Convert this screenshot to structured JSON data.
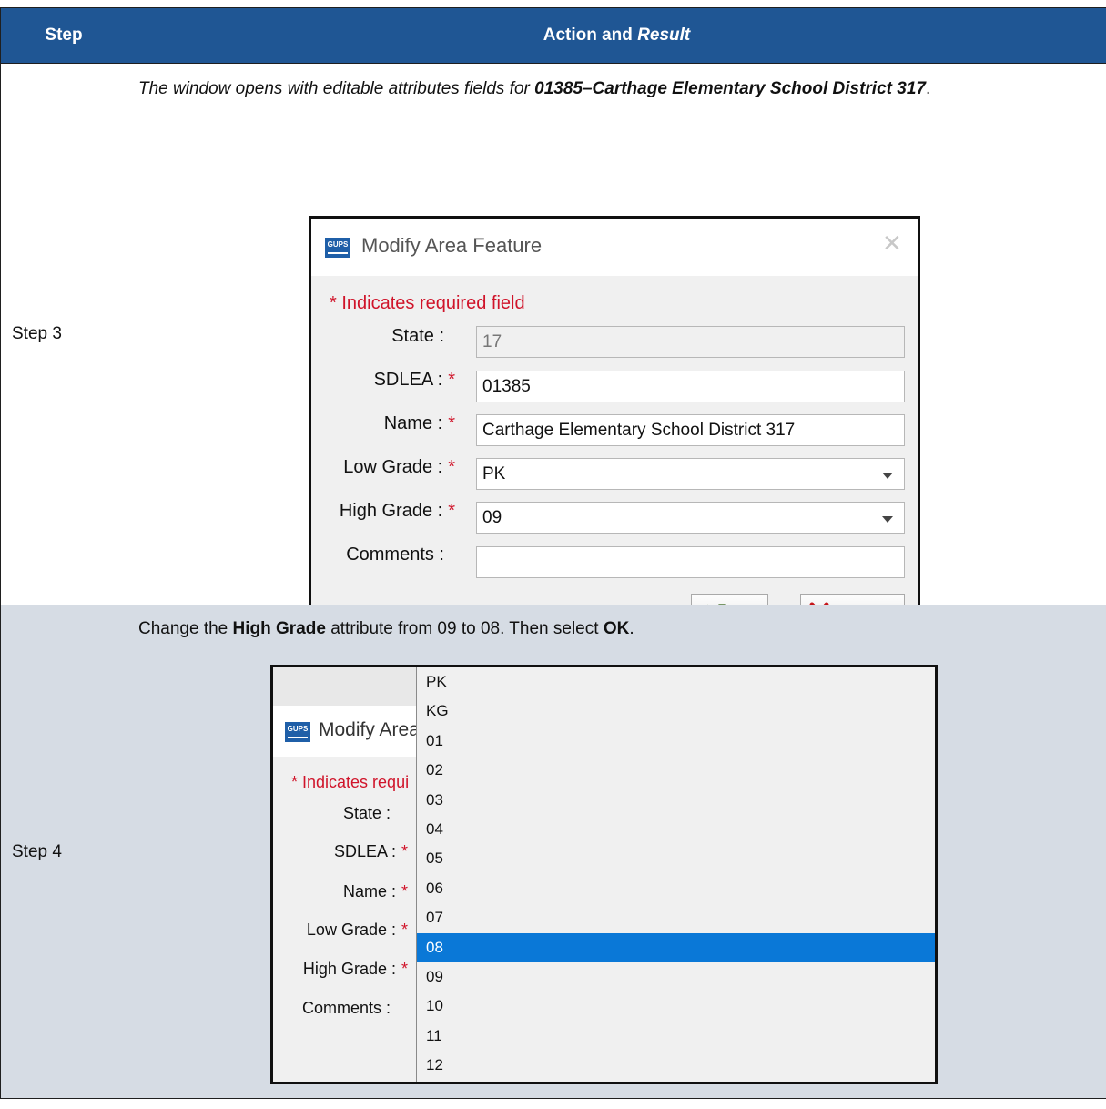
{
  "header": {
    "step": "Step",
    "action": "Action and",
    "result": "Result"
  },
  "rows": {
    "step3": {
      "label": "Step 3",
      "text_pre": "The window opens with editable attributes fields for ",
      "text_bold": "01385–Carthage Elementary School District 317",
      "text_post": "."
    },
    "step4": {
      "label": "Step 4",
      "t1": "Change the ",
      "t2": "High Grade",
      "t3": " attribute from 09 to 08. Then select ",
      "t4": "OK",
      "t5": "."
    }
  },
  "dialog": {
    "logo": "GUPS",
    "title": "Modify Area Feature",
    "title_truncated": "Modify Area",
    "close_icon": "close-icon",
    "required_note": "* Indicates required field",
    "required_note_truncated": "* Indicates requi",
    "star": "*",
    "fields": {
      "state": {
        "label": "State :",
        "value": "17"
      },
      "sdlea": {
        "label": "SDLEA :",
        "value": "01385"
      },
      "name": {
        "label": "Name :",
        "value": "Carthage Elementary School District 317"
      },
      "low_grade": {
        "label": "Low Grade :",
        "value": "PK"
      },
      "high_grade": {
        "label": "High Grade :",
        "value": "09"
      },
      "comments": {
        "label": "Comments :",
        "value": ""
      }
    },
    "ok_label": "Ok",
    "cancel_label": "Cancel"
  },
  "dropdown": {
    "options": [
      "PK",
      "KG",
      "01",
      "02",
      "03",
      "04",
      "05",
      "06",
      "07",
      "08",
      "09",
      "10",
      "11",
      "12"
    ],
    "selected": "08"
  },
  "colors": {
    "header_bg": "#1f5694",
    "row4_bg": "#d6dce4",
    "required_red": "#d0142a",
    "selection_blue": "#0a78d7"
  }
}
